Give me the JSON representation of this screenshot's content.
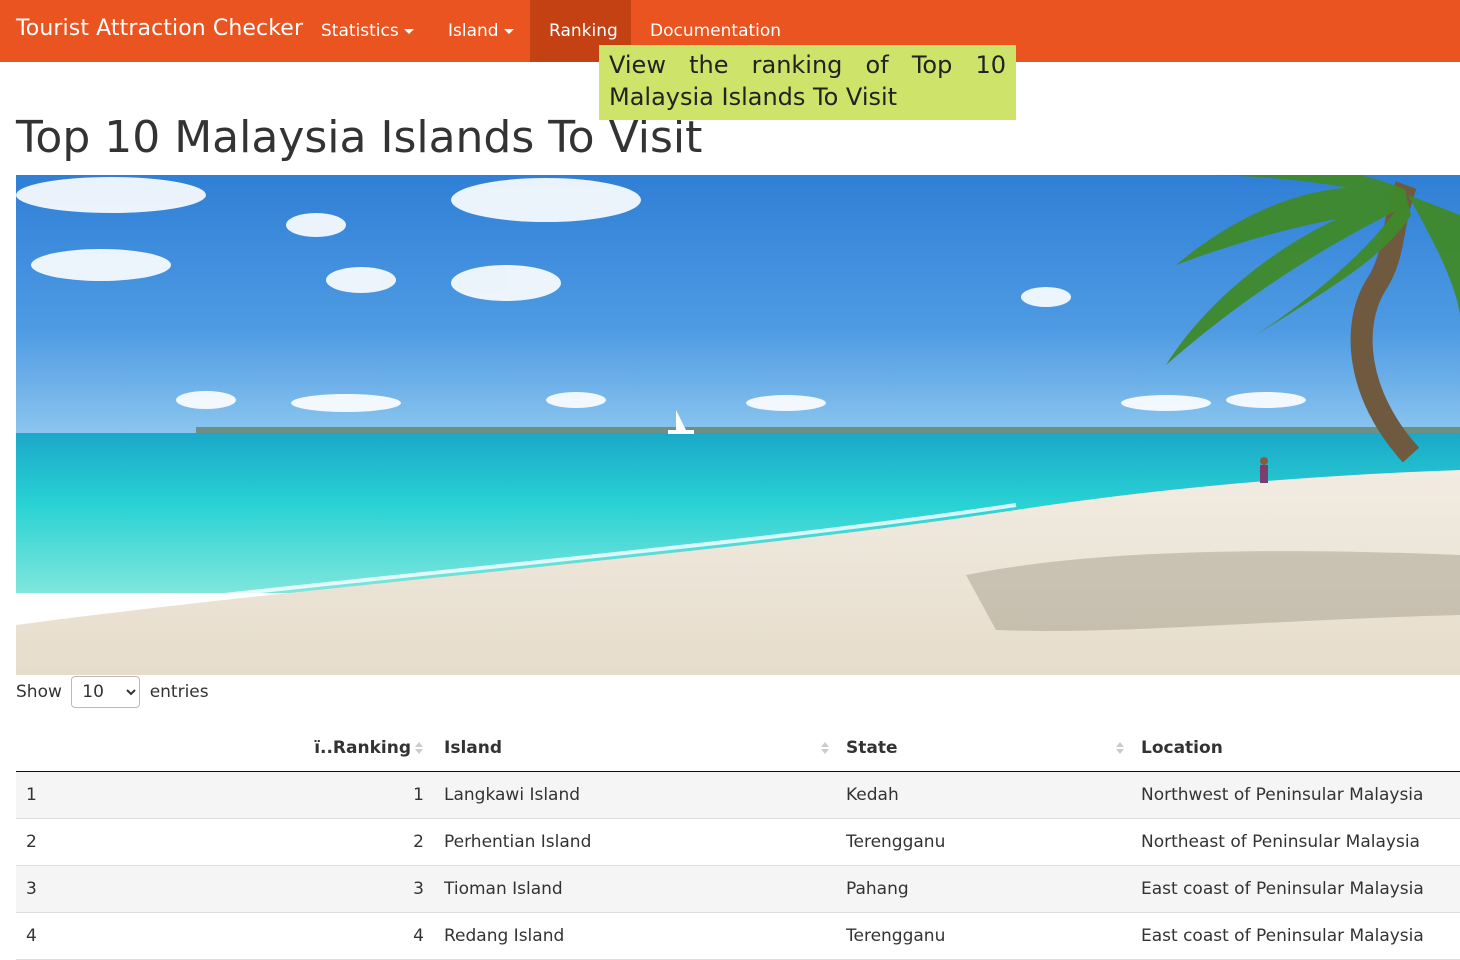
{
  "navbar": {
    "brand": "Tourist Attraction Checker",
    "items": [
      {
        "label": "Statistics",
        "dropdown": true
      },
      {
        "label": "Island",
        "dropdown": true
      },
      {
        "label": "Ranking",
        "active": true
      },
      {
        "label": "Documentation"
      }
    ],
    "colors": {
      "background": "#e95420",
      "active": "#c34113"
    }
  },
  "tooltip": {
    "text": "View the ranking of Top 10 Malaysia Islands To Visit",
    "color": "#cde36a"
  },
  "page": {
    "title": "Top 10 Malaysia Islands To Visit"
  },
  "entries": {
    "show_label": "Show",
    "selected": "10",
    "options": [
      "10"
    ],
    "suffix": "entries"
  },
  "table": {
    "columns": [
      "",
      "ï..Ranking",
      "Island",
      "State",
      "Location"
    ],
    "rows": [
      {
        "index": "1",
        "ranking": "1",
        "island": "Langkawi Island",
        "state": "Kedah",
        "location": "Northwest of Peninsular Malaysia"
      },
      {
        "index": "2",
        "ranking": "2",
        "island": "Perhentian Island",
        "state": "Terengganu",
        "location": "Northeast of Peninsular Malaysia"
      },
      {
        "index": "3",
        "ranking": "3",
        "island": "Tioman Island",
        "state": "Pahang",
        "location": "East coast of Peninsular Malaysia"
      },
      {
        "index": "4",
        "ranking": "4",
        "island": "Redang Island",
        "state": "Terengganu",
        "location": "East coast of Peninsular Malaysia"
      }
    ]
  }
}
